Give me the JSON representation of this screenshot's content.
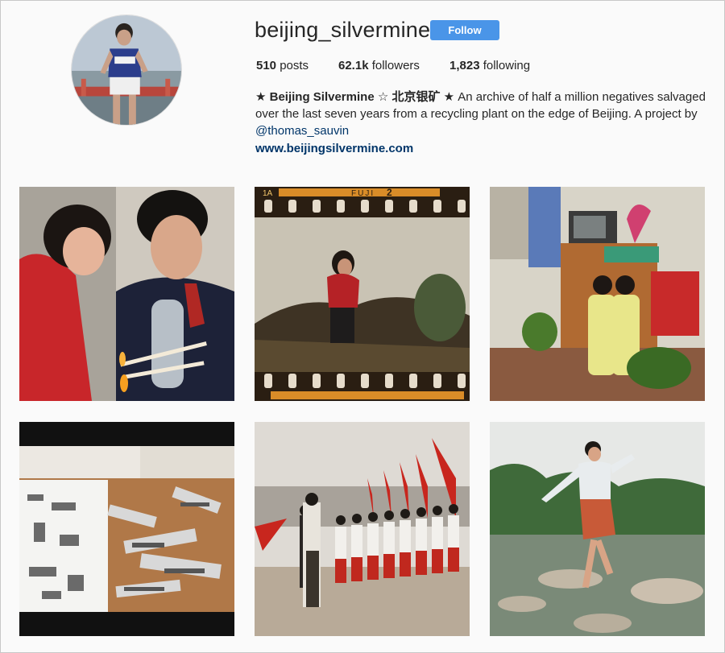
{
  "profile": {
    "username": "beijing_silvermine",
    "follow_label": "Follow"
  },
  "stats": {
    "posts_count": "510",
    "posts_label": "posts",
    "followers_count": "62.1k",
    "followers_label": "followers",
    "following_count": "1,823",
    "following_label": "following"
  },
  "bio": {
    "name": "★ Beijing Silvermine ☆ 北京银矿 ★",
    "text": " An archive of half a million negatives salvaged over the last seven years from a recycling plant on the edge of Beijing. A project by ",
    "mention": "@thomas_sauvin",
    "website": "www.beijingsilvermine.com"
  },
  "film_text": {
    "frame_number": "1A",
    "brand": "FUJI",
    "frame_index": "2"
  },
  "colors": {
    "follow_button": "#4a95e8",
    "link": "#003569",
    "background": "#fafafa"
  },
  "posts": [
    {
      "subject": "couple-lighting-cigarettes"
    },
    {
      "subject": "woman-on-rock-film-strip"
    },
    {
      "subject": "twin-girls-living-room"
    },
    {
      "subject": "negatives-on-table"
    },
    {
      "subject": "parade-with-red-flags"
    },
    {
      "subject": "woman-jumping-by-pond"
    }
  ]
}
